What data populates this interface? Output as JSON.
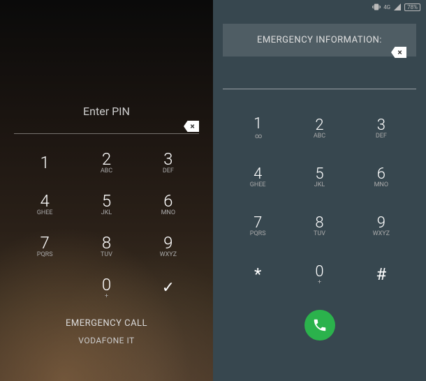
{
  "left": {
    "enter_pin": "Enter PIN",
    "emergency_call": "EMERGENCY CALL",
    "carrier": "VODAFONE IT",
    "keys": {
      "k1": {
        "digit": "1",
        "label": ""
      },
      "k2": {
        "digit": "2",
        "label": "ABC"
      },
      "k3": {
        "digit": "3",
        "label": "DEF"
      },
      "k4": {
        "digit": "4",
        "label": "Ghee"
      },
      "k5": {
        "digit": "5",
        "label": "JKL"
      },
      "k6": {
        "digit": "6",
        "label": "MNO"
      },
      "k7": {
        "digit": "7",
        "label": "PQRS"
      },
      "k8": {
        "digit": "8",
        "label": "TUV"
      },
      "k9": {
        "digit": "9",
        "label": "Wxyz"
      },
      "k0": {
        "digit": "0",
        "label": "+"
      }
    }
  },
  "right": {
    "emergency_info": "EMERGENCY INFORMATION:",
    "status": {
      "network": "4G",
      "battery": "78%"
    },
    "keys": {
      "k1": {
        "digit": "1",
        "label": "∞"
      },
      "k2": {
        "digit": "2",
        "label": "ABC"
      },
      "k3": {
        "digit": "3",
        "label": "DEF"
      },
      "k4": {
        "digit": "4",
        "label": "Ghee"
      },
      "k5": {
        "digit": "5",
        "label": "JKL"
      },
      "k6": {
        "digit": "6",
        "label": "MNO"
      },
      "k7": {
        "digit": "7",
        "label": "PQRS"
      },
      "k8": {
        "digit": "8",
        "label": "TUV"
      },
      "k9": {
        "digit": "9",
        "label": "WXYZ"
      },
      "kstar": {
        "digit": "*",
        "label": ""
      },
      "k0": {
        "digit": "0",
        "label": "+"
      },
      "khash": {
        "digit": "#",
        "label": ""
      }
    }
  }
}
